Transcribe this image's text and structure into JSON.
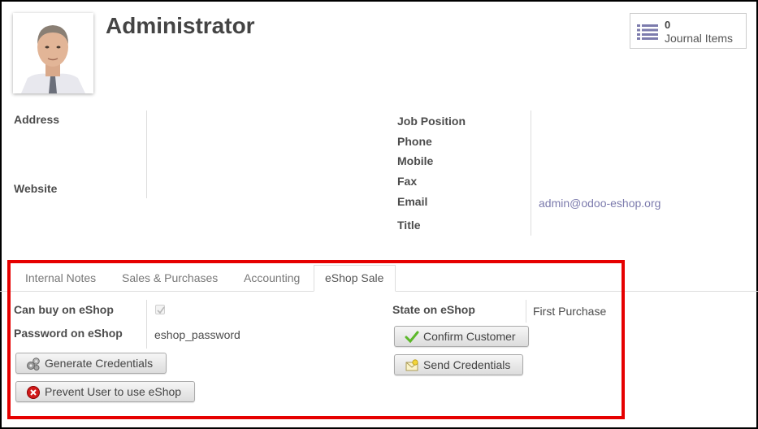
{
  "record": {
    "name": "Administrator"
  },
  "smart_button": {
    "count": "0",
    "label": "Journal Items",
    "icon": "list-icon"
  },
  "fields_left": {
    "address": "Address",
    "website": "Website"
  },
  "fields_right": {
    "job_position": "Job Position",
    "phone": "Phone",
    "mobile": "Mobile",
    "fax": "Fax",
    "email": "Email",
    "email_value": "admin@odoo-eshop.org",
    "title": "Title"
  },
  "tabs": [
    {
      "label": "Internal Notes"
    },
    {
      "label": "Sales & Purchases"
    },
    {
      "label": "Accounting"
    },
    {
      "label": "eShop Sale",
      "active": true
    }
  ],
  "eshop": {
    "can_buy_label": "Can buy on eShop",
    "can_buy_value": true,
    "password_label": "Password on eShop",
    "password_value": "eshop_password",
    "state_label": "State on eShop",
    "state_value": "First Purchase",
    "buttons": {
      "generate": "Generate Credentials",
      "prevent": "Prevent User to use eShop",
      "confirm": "Confirm Customer",
      "send": "Send Credentials"
    }
  },
  "colors": {
    "highlight": "#e60000",
    "link": "#7c7bad",
    "icon_purple": "#7c7bad"
  }
}
